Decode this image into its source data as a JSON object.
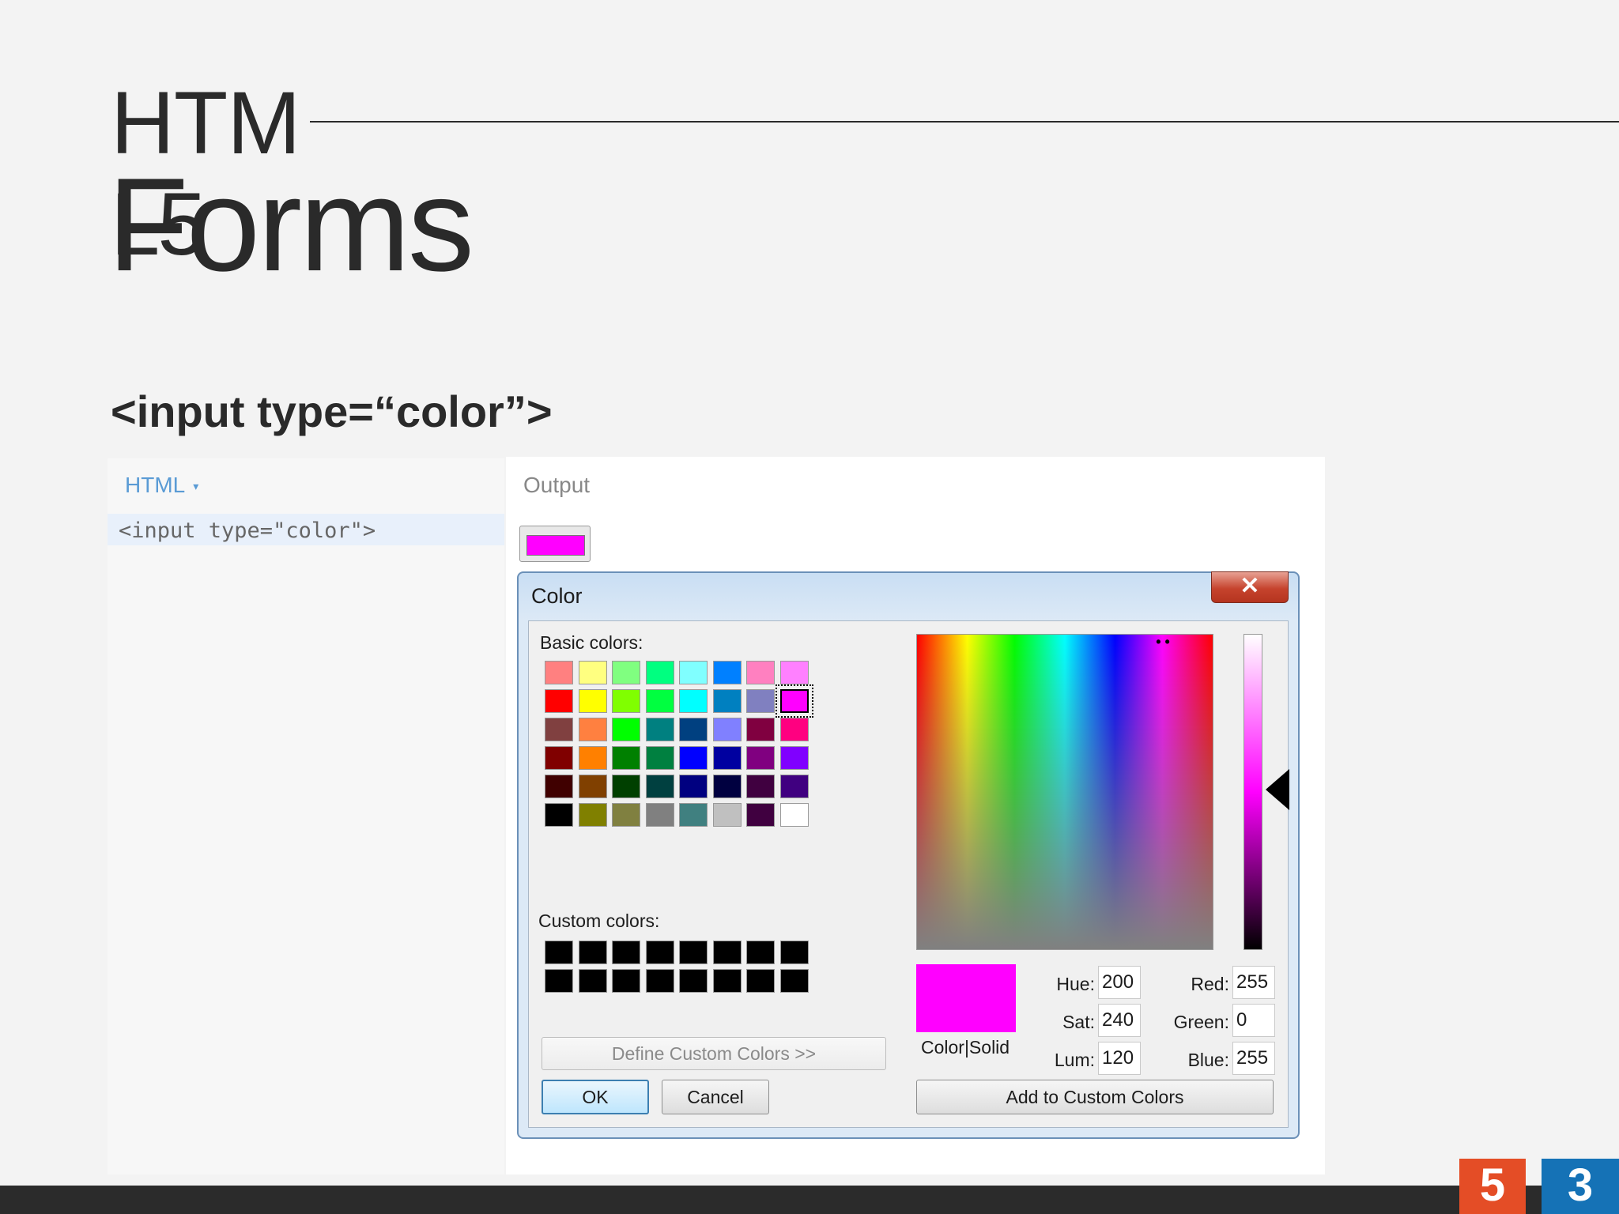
{
  "slide": {
    "title_line1": "HTM",
    "title_line2": "L5",
    "title_forms": "Forms",
    "subtitle": "<input type=“color”>"
  },
  "editor": {
    "tab_label": "HTML",
    "tab_caret": "▾",
    "code": "<input type=\"color\">"
  },
  "output": {
    "label": "Output",
    "input_value_color": "#ff00ff"
  },
  "dialog": {
    "title": "Color",
    "close_glyph": "✕",
    "basic_colors_label": "Basic colors:",
    "basic_colors": [
      [
        "#ff8080",
        "#ffff80",
        "#80ff80",
        "#00ff80",
        "#80ffff",
        "#0080ff",
        "#ff80c0",
        "#ff80ff"
      ],
      [
        "#ff0000",
        "#ffff00",
        "#80ff00",
        "#00ff40",
        "#00ffff",
        "#0080c0",
        "#8080c0",
        "#ff00ff"
      ],
      [
        "#804040",
        "#ff8040",
        "#00ff00",
        "#008080",
        "#004080",
        "#8080ff",
        "#800040",
        "#ff0080"
      ],
      [
        "#800000",
        "#ff8000",
        "#008000",
        "#008040",
        "#0000ff",
        "#0000a0",
        "#800080",
        "#8000ff"
      ],
      [
        "#400000",
        "#804000",
        "#004000",
        "#004040",
        "#000080",
        "#000040",
        "#400040",
        "#400080"
      ],
      [
        "#000000",
        "#808000",
        "#808040",
        "#808080",
        "#408080",
        "#c0c0c0",
        "#400040",
        "#ffffff"
      ]
    ],
    "selected_basic": {
      "row": 1,
      "col": 7
    },
    "custom_colors_label": "Custom colors:",
    "custom_colors": [
      [
        "#000000",
        "#000000",
        "#000000",
        "#000000",
        "#000000",
        "#000000",
        "#000000",
        "#000000"
      ],
      [
        "#000000",
        "#000000",
        "#000000",
        "#000000",
        "#000000",
        "#000000",
        "#000000",
        "#000000"
      ]
    ],
    "define_custom_label": "Define Custom Colors >>",
    "ok_label": "OK",
    "cancel_label": "Cancel",
    "preview_label": "Color|Solid",
    "preview_color": "#ff00ff",
    "hue_label": "Hue:",
    "hue_value": "200",
    "sat_label": "Sat:",
    "sat_value": "240",
    "lum_label": "Lum:",
    "lum_value": "120",
    "red_label": "Red:",
    "red_value": "255",
    "green_label": "Green:",
    "green_value": "0",
    "blue_label": "Blue:",
    "blue_value": "255",
    "add_custom_label": "Add to Custom Colors",
    "crosshair_glyph": "• •"
  },
  "footer": {
    "html5_logo": "5",
    "css3_logo": "3"
  }
}
